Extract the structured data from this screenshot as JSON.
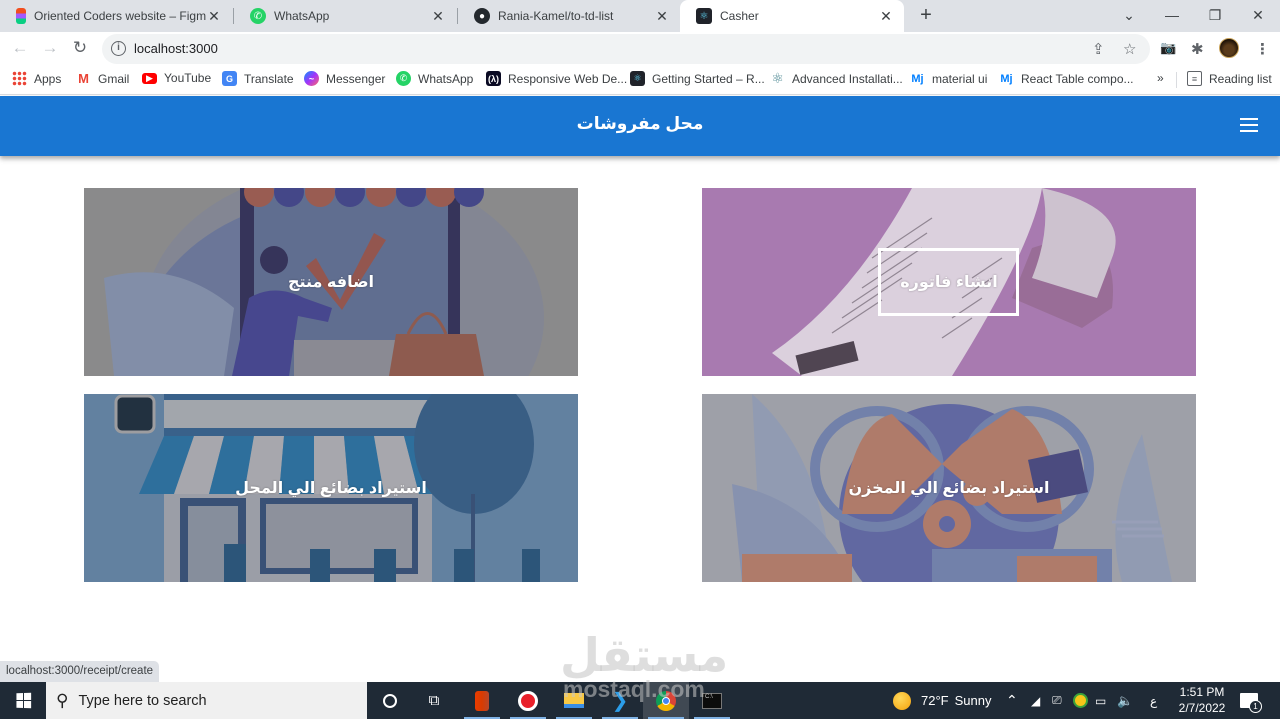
{
  "browser": {
    "tabs": [
      {
        "title": "Oriented Coders website – Figma",
        "icon": "figma-icon",
        "active": false
      },
      {
        "title": "WhatsApp",
        "icon": "whatsapp-icon",
        "active": false
      },
      {
        "title": "Rania-Kamel/to-td-list",
        "icon": "github-icon",
        "active": false
      },
      {
        "title": "Casher",
        "icon": "react-icon",
        "active": true
      }
    ],
    "tab_close_glyph": "✕",
    "new_tab_glyph": "+",
    "window_controls": {
      "tab_search": "⌄",
      "minimize": "—",
      "restore": "❐",
      "close": "✕"
    },
    "nav": {
      "back": "←",
      "forward": "→",
      "reload": "↻"
    },
    "url": "localhost:3000",
    "site_info_glyph": "i",
    "omnibox_icons": {
      "share": "⇪",
      "bookmark": "☆"
    },
    "toolbar_icons": {
      "screenshot": "📷",
      "extensions": "✱",
      "menu": "⋮"
    },
    "bookmarks": [
      {
        "label": "Apps",
        "icon": "apps-grid-icon"
      },
      {
        "label": "Gmail",
        "icon": "gmail-icon"
      },
      {
        "label": "YouTube",
        "icon": "youtube-icon"
      },
      {
        "label": "Translate",
        "icon": "translate-icon"
      },
      {
        "label": "Messenger",
        "icon": "messenger-icon"
      },
      {
        "label": "WhatsApp",
        "icon": "whatsapp-icon"
      },
      {
        "label": "Responsive Web De...",
        "icon": "freecodecamp-icon"
      },
      {
        "label": "Getting Started – R...",
        "icon": "react-icon"
      },
      {
        "label": "Advanced Installati...",
        "icon": "electron-icon"
      },
      {
        "label": "material ui",
        "icon": "mui-icon"
      },
      {
        "label": "React Table compo...",
        "icon": "mui-icon"
      }
    ],
    "bookmarks_overflow": "»",
    "reading_list": "Reading list",
    "status_url": "localhost:3000/receipt/create"
  },
  "app": {
    "title": "محل مفروشات",
    "accent_color": "#1976d2",
    "cards": [
      {
        "id": "add-product",
        "label": "اضافه منتج",
        "focused": false
      },
      {
        "id": "create-receipt",
        "label": "انشاء فاتوره",
        "focused": true
      },
      {
        "id": "import-to-shop",
        "label": "استيراد بضائع الي المحل",
        "focused": false
      },
      {
        "id": "import-to-store",
        "label": "استيراد بضائع الي المخزن",
        "focused": false
      }
    ]
  },
  "watermark": {
    "arabic": "مستقل",
    "latin": "mostaql.com"
  },
  "taskbar": {
    "search_placeholder": "Type here to search",
    "apps": [
      "cortana",
      "task-view",
      "office",
      "recorder",
      "file-explorer",
      "vscode",
      "chrome",
      "terminal"
    ],
    "weather": {
      "temp": "72°F",
      "condition": "Sunny"
    },
    "input_language": "ع",
    "time": "1:51 PM",
    "date": "2/7/2022",
    "notification_count": "1"
  }
}
